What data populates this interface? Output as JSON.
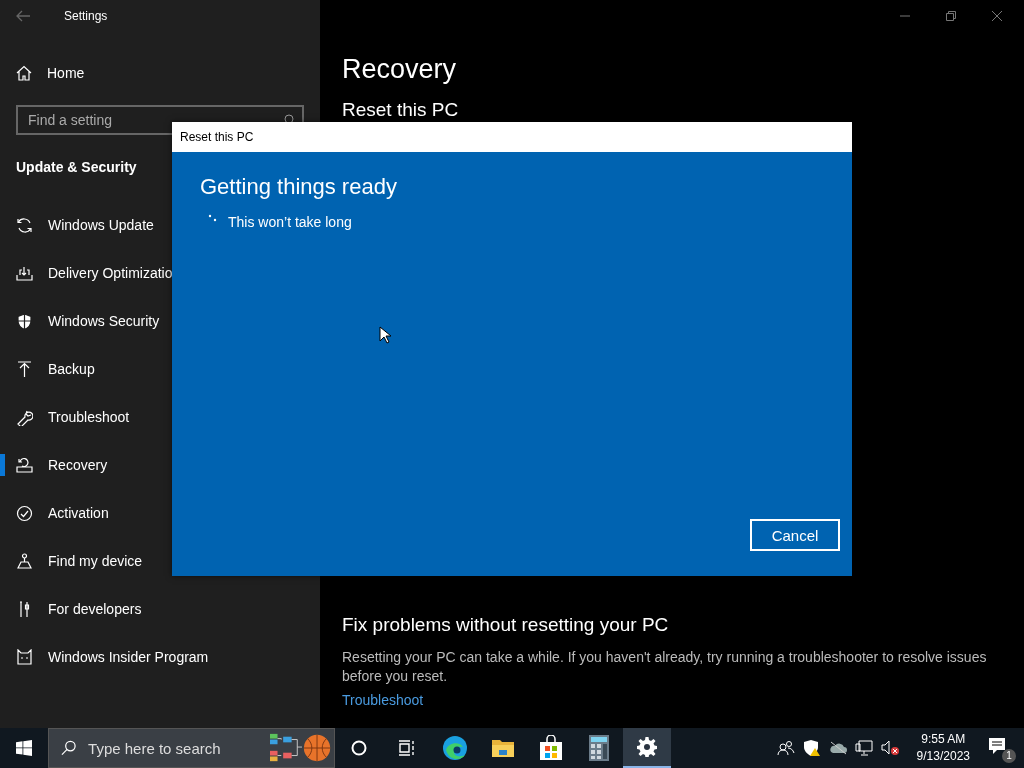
{
  "window": {
    "title": "Settings"
  },
  "sidebar": {
    "home": "Home",
    "search": {
      "placeholder": "Find a setting"
    },
    "section": "Update & Security",
    "items": [
      {
        "kind": "sync",
        "label": "Windows Update",
        "selected": false
      },
      {
        "kind": "delivery",
        "label": "Delivery Optimizatio",
        "selected": false
      },
      {
        "kind": "shield",
        "label": "Windows Security",
        "selected": false
      },
      {
        "kind": "backup",
        "label": "Backup",
        "selected": false
      },
      {
        "kind": "wrench",
        "label": "Troubleshoot",
        "selected": false
      },
      {
        "kind": "recovery",
        "label": "Recovery",
        "selected": true
      },
      {
        "kind": "check",
        "label": "Activation",
        "selected": false
      },
      {
        "kind": "find",
        "label": "Find my device",
        "selected": false
      },
      {
        "kind": "dev",
        "label": "For developers",
        "selected": false
      },
      {
        "kind": "insider",
        "label": "Windows Insider Program",
        "selected": false
      }
    ]
  },
  "content": {
    "title": "Recovery",
    "section": "Reset this PC",
    "fix_title": "Fix problems without resetting your PC",
    "fix_text": "Resetting your PC can take a while. If you haven't already, try running a troubleshooter to resolve issues before you reset.",
    "fix_link": "Troubleshoot"
  },
  "dialog": {
    "title": "Reset this PC",
    "heading": "Getting things ready",
    "status": "This won’t take long",
    "button": "Cancel"
  },
  "taskbar": {
    "search_placeholder": "Type here to search",
    "apps": [
      {
        "kind": "cortana",
        "selected": false
      },
      {
        "kind": "taskview",
        "selected": false
      },
      {
        "kind": "edge",
        "selected": false
      },
      {
        "kind": "explorer",
        "selected": false
      },
      {
        "kind": "store",
        "selected": false
      },
      {
        "kind": "calculator",
        "selected": false
      },
      {
        "kind": "settings",
        "selected": true
      }
    ],
    "time": "9:55 AM",
    "date": "9/13/2023",
    "notification_count": "1"
  }
}
